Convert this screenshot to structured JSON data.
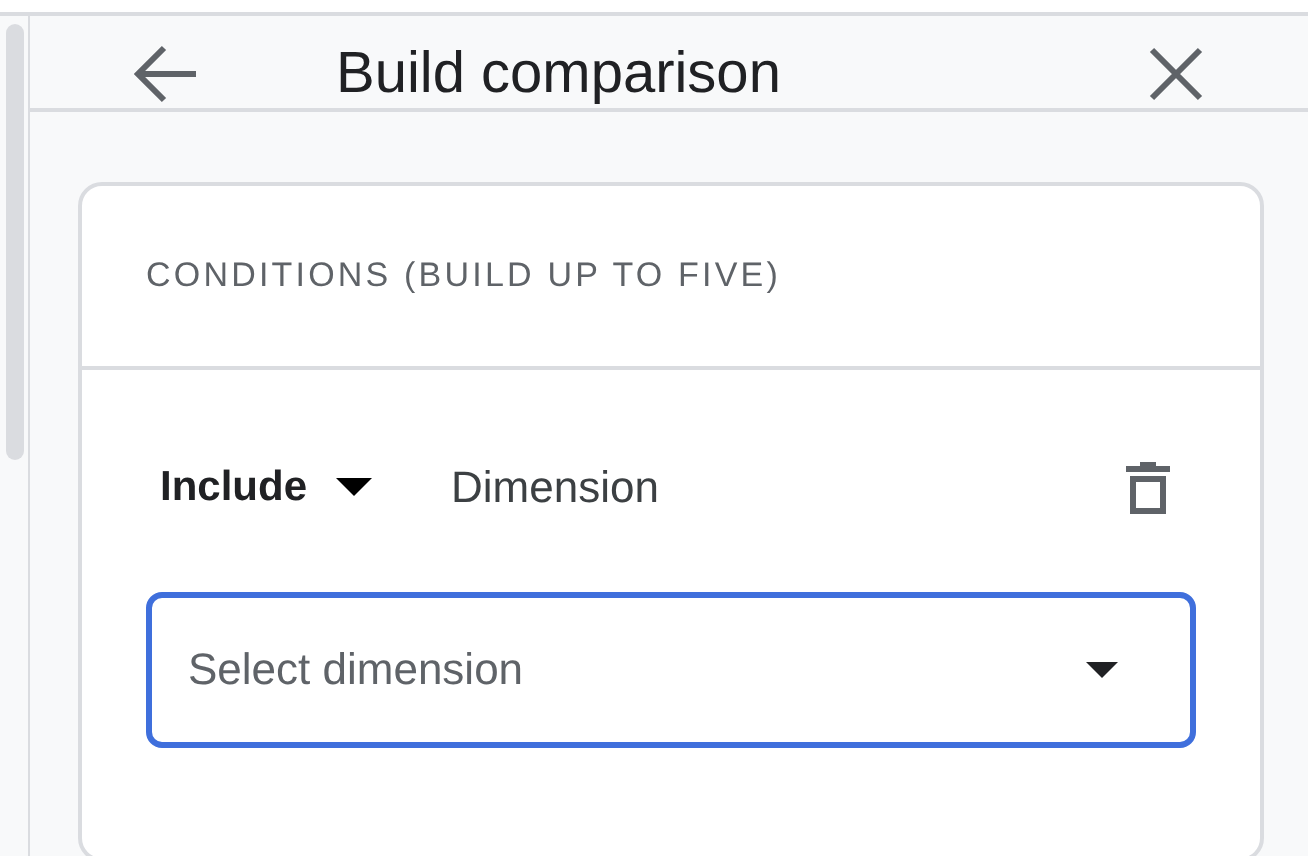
{
  "header": {
    "title": "Build comparison"
  },
  "conditions": {
    "heading": "CONDITIONS (BUILD UP TO FIVE)",
    "rows": [
      {
        "mode": "Include",
        "label": "Dimension",
        "field": {
          "placeholder": "Select dimension",
          "focused": true
        }
      }
    ]
  }
}
